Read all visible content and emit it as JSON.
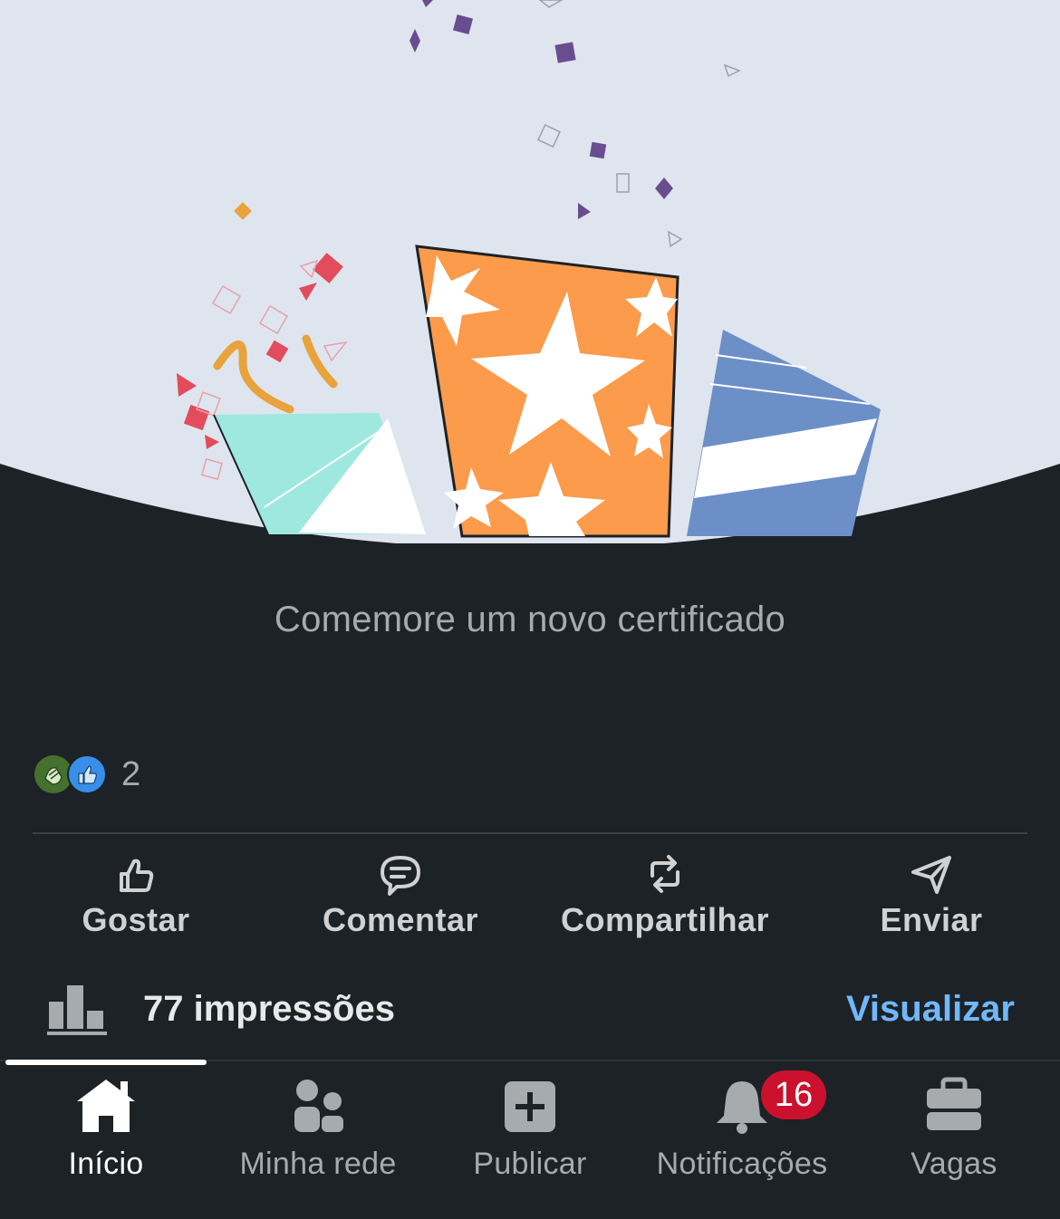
{
  "post": {
    "caption": "Comemore um novo certificado",
    "reaction_count": "2",
    "reaction_icons": [
      "celebrate-icon",
      "like-icon"
    ]
  },
  "actions": [
    {
      "label": "Gostar",
      "icon": "thumbs-up-icon"
    },
    {
      "label": "Comentar",
      "icon": "comment-icon"
    },
    {
      "label": "Compartilhar",
      "icon": "repost-icon"
    },
    {
      "label": "Enviar",
      "icon": "send-icon"
    }
  ],
  "impressions": {
    "text": "77 impressões",
    "link_label": "Visualizar",
    "icon": "bar-chart-icon"
  },
  "bottom_nav": {
    "items": [
      {
        "label": "Início",
        "icon": "home-icon",
        "active": true
      },
      {
        "label": "Minha rede",
        "icon": "network-icon",
        "active": false
      },
      {
        "label": "Publicar",
        "icon": "plus-square-icon",
        "active": false
      },
      {
        "label": "Notificações",
        "icon": "bell-icon",
        "active": false,
        "badge": "16"
      },
      {
        "label": "Vagas",
        "icon": "briefcase-icon",
        "active": false
      }
    ]
  },
  "colors": {
    "background": "#1d2226",
    "hero_background": "#dfe5ee",
    "link": "#71b7fb",
    "badge": "#cb112d",
    "caption": "#a8abae"
  }
}
